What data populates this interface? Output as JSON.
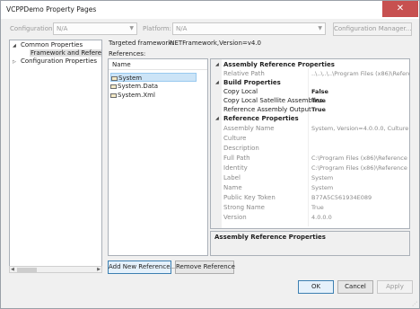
{
  "window": {
    "title": "VCPPDemo Property Pages",
    "close_glyph": "✕"
  },
  "config_bar": {
    "configuration_label": "Configuration:",
    "configuration_value": "N/A",
    "platform_label": "Platform:",
    "platform_value": "N/A",
    "config_manager_label": "Configuration Manager..."
  },
  "tree": {
    "items": [
      {
        "label": "Common Properties",
        "expanded": true
      },
      {
        "label": "Framework and References",
        "selected": true
      },
      {
        "label": "Configuration Properties",
        "expanded": false
      }
    ]
  },
  "framework": {
    "label": "Targeted framework:",
    "value": ".NETFramework,Version=v4.0"
  },
  "references": {
    "label": "References:",
    "column_header": "Name",
    "items": [
      "System",
      "System.Data",
      "System.Xml"
    ],
    "selected_index": 0
  },
  "properties": {
    "categories": [
      {
        "name": "Assembly Reference Properties",
        "rows": [
          {
            "name": "Relative Path",
            "value": "..\\..\\..\\..\\Program Files (x86)\\Reference",
            "readonly": true
          }
        ]
      },
      {
        "name": "Build Properties",
        "rows": [
          {
            "name": "Copy Local",
            "value": "False",
            "bold": true
          },
          {
            "name": "Copy Local Satellite Assemblies",
            "value": "True",
            "bold": true
          },
          {
            "name": "Reference Assembly Output",
            "value": "True",
            "bold": true
          }
        ]
      },
      {
        "name": "Reference Properties",
        "rows": [
          {
            "name": "Assembly Name",
            "value": "System, Version=4.0.0.0, Culture=neu",
            "readonly": true
          },
          {
            "name": "Culture",
            "value": "",
            "readonly": true
          },
          {
            "name": "Description",
            "value": "",
            "readonly": true
          },
          {
            "name": "Full Path",
            "value": "C:\\Program Files (x86)\\Reference Ass",
            "readonly": true
          },
          {
            "name": "Identity",
            "value": "C:\\Program Files (x86)\\Reference Ass",
            "readonly": true
          },
          {
            "name": "Label",
            "value": "System",
            "readonly": true
          },
          {
            "name": "Name",
            "value": "System",
            "readonly": true
          },
          {
            "name": "Public Key Token",
            "value": "B77A5C561934E089",
            "readonly": true
          },
          {
            "name": "Strong Name",
            "value": "True",
            "readonly": true
          },
          {
            "name": "Version",
            "value": "4.0.0.0",
            "readonly": true
          }
        ]
      }
    ],
    "description_title": "Assembly Reference Properties"
  },
  "buttons": {
    "add_new_reference": "Add New Reference...",
    "remove_reference": "Remove Reference",
    "ok": "OK",
    "cancel": "Cancel",
    "apply": "Apply"
  },
  "colors": {
    "accent": "#3c7fb1",
    "selection": "#cce4f7",
    "close_red": "#c75050"
  }
}
